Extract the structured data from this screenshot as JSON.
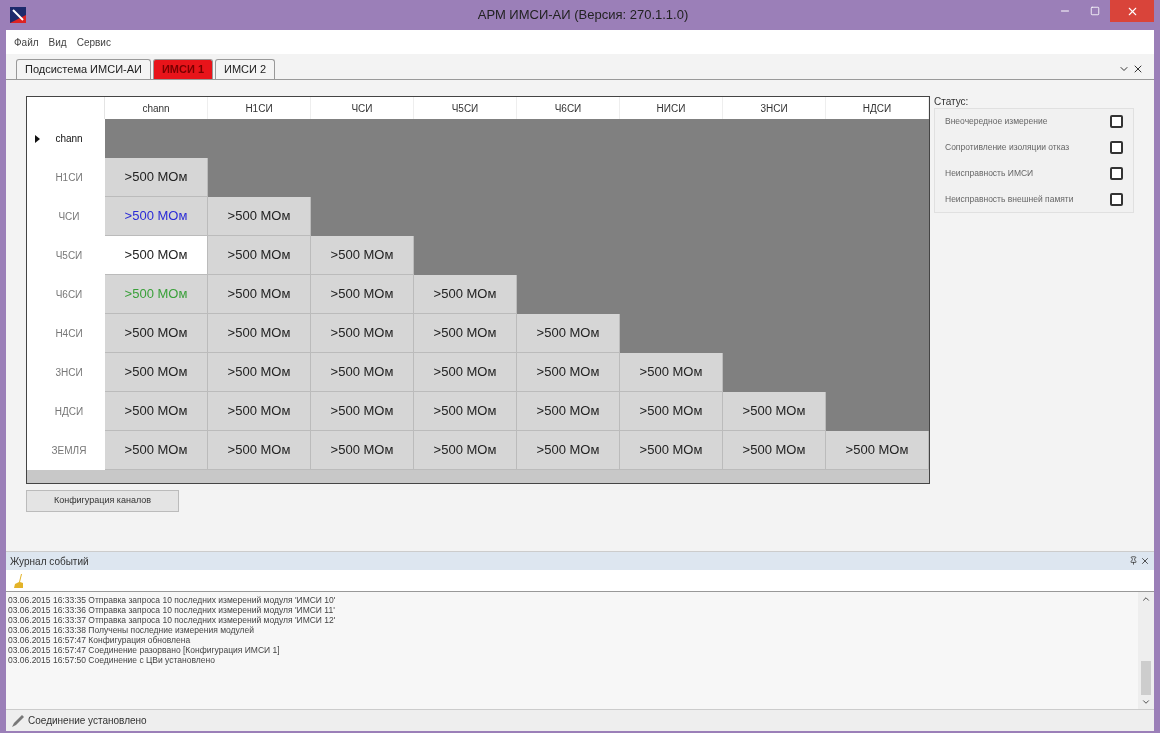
{
  "window": {
    "title": "АРМ ИМСИ-АИ (Версия: 270.1.1.0)"
  },
  "menu": [
    "Файл",
    "Вид",
    "Сервис"
  ],
  "tabs": [
    {
      "label": "Подсистема ИМСИ-АИ",
      "selected": false
    },
    {
      "label": "ИМСИ 1",
      "selected": true
    },
    {
      "label": "ИМСИ 2",
      "selected": false
    }
  ],
  "grid": {
    "columns": [
      "chann",
      "Н1СИ",
      "ЧСИ",
      "Ч5СИ",
      "Ч6СИ",
      "НИСИ",
      "3НСИ",
      "НДСИ"
    ],
    "rows": [
      {
        "label": "chann",
        "current": true,
        "cells": []
      },
      {
        "label": "Н1СИ",
        "current": false,
        "cells": [
          {
            "text": ">500 МОм",
            "color": "#222222",
            "selected": false
          }
        ]
      },
      {
        "label": "ЧСИ",
        "current": false,
        "cells": [
          {
            "text": ">500 МОм",
            "color": "#2b2bd6",
            "selected": false
          },
          {
            "text": ">500 МОм",
            "color": "#222222",
            "selected": false
          }
        ]
      },
      {
        "label": "Ч5СИ",
        "current": false,
        "cells": [
          {
            "text": ">500 МОм",
            "color": "#222222",
            "selected": true
          },
          {
            "text": ">500 МОм",
            "color": "#222222",
            "selected": false
          },
          {
            "text": ">500 МОм",
            "color": "#222222",
            "selected": false
          }
        ]
      },
      {
        "label": "Ч6СИ",
        "current": false,
        "cells": [
          {
            "text": ">500 МОм",
            "color": "#3aa03a",
            "selected": false
          },
          {
            "text": ">500 МОм",
            "color": "#222222",
            "selected": false
          },
          {
            "text": ">500 МОм",
            "color": "#222222",
            "selected": false
          },
          {
            "text": ">500 МОм",
            "color": "#222222",
            "selected": false
          }
        ]
      },
      {
        "label": "Н4СИ",
        "current": false,
        "cells": [
          {
            "text": ">500 МОм",
            "color": "#222222",
            "selected": false
          },
          {
            "text": ">500 МОм",
            "color": "#222222",
            "selected": false
          },
          {
            "text": ">500 МОм",
            "color": "#222222",
            "selected": false
          },
          {
            "text": ">500 МОм",
            "color": "#222222",
            "selected": false
          },
          {
            "text": ">500 МОм",
            "color": "#222222",
            "selected": false
          }
        ]
      },
      {
        "label": "3НСИ",
        "current": false,
        "cells": [
          {
            "text": ">500 МОм",
            "color": "#222222",
            "selected": false
          },
          {
            "text": ">500 МОм",
            "color": "#222222",
            "selected": false
          },
          {
            "text": ">500 МОм",
            "color": "#222222",
            "selected": false
          },
          {
            "text": ">500 МОм",
            "color": "#222222",
            "selected": false
          },
          {
            "text": ">500 МОм",
            "color": "#222222",
            "selected": false
          },
          {
            "text": ">500 МОм",
            "color": "#222222",
            "selected": false
          }
        ]
      },
      {
        "label": "НДСИ",
        "current": false,
        "cells": [
          {
            "text": ">500 МОм",
            "color": "#222222",
            "selected": false
          },
          {
            "text": ">500 МОм",
            "color": "#222222",
            "selected": false
          },
          {
            "text": ">500 МОм",
            "color": "#222222",
            "selected": false
          },
          {
            "text": ">500 МОм",
            "color": "#222222",
            "selected": false
          },
          {
            "text": ">500 МОм",
            "color": "#222222",
            "selected": false
          },
          {
            "text": ">500 МОм",
            "color": "#222222",
            "selected": false
          },
          {
            "text": ">500 МОм",
            "color": "#222222",
            "selected": false
          }
        ]
      },
      {
        "label": "ЗЕМЛЯ",
        "current": false,
        "cells": [
          {
            "text": ">500 МОм",
            "color": "#222222",
            "selected": false
          },
          {
            "text": ">500 МОм",
            "color": "#222222",
            "selected": false
          },
          {
            "text": ">500 МОм",
            "color": "#222222",
            "selected": false
          },
          {
            "text": ">500 МОм",
            "color": "#222222",
            "selected": false
          },
          {
            "text": ">500 МОм",
            "color": "#222222",
            "selected": false
          },
          {
            "text": ">500 МОм",
            "color": "#222222",
            "selected": false
          },
          {
            "text": ">500 МОм",
            "color": "#222222",
            "selected": false
          },
          {
            "text": ">500 МОм",
            "color": "#222222",
            "selected": false
          }
        ]
      }
    ]
  },
  "config_button": "Конфигурация каналов",
  "status_panel": {
    "title": "Статус:",
    "items": [
      {
        "label": "Внеочередное измерение",
        "checked": false
      },
      {
        "label": "Сопротивление изоляции отказ",
        "checked": false
      },
      {
        "label": "Неисправность ИМСИ",
        "checked": false
      },
      {
        "label": "Неисправность внешней памяти",
        "checked": false
      }
    ]
  },
  "journal": {
    "title": "Журнал событий",
    "lines": [
      "03.06.2015 16:33:35 Отправка запроса 10 последних измерений модуля 'ИМСИ 10'",
      "03.06.2015 16:33:36 Отправка запроса 10 последних измерений модуля 'ИМСИ 11'",
      "03.06.2015 16:33:37 Отправка запроса 10 последних измерений модуля 'ИМСИ 12'",
      "03.06.2015 16:33:38 Получены последние измерения модулей",
      "03.06.2015 16:57:47 Конфигурация обновлена",
      "03.06.2015 16:57:47 Соединение разорвано [Конфигурация ИМСИ 1]",
      "03.06.2015 16:57:50 Соединение с ЦВи установлено"
    ]
  },
  "status_bar": "Соединение установлено"
}
